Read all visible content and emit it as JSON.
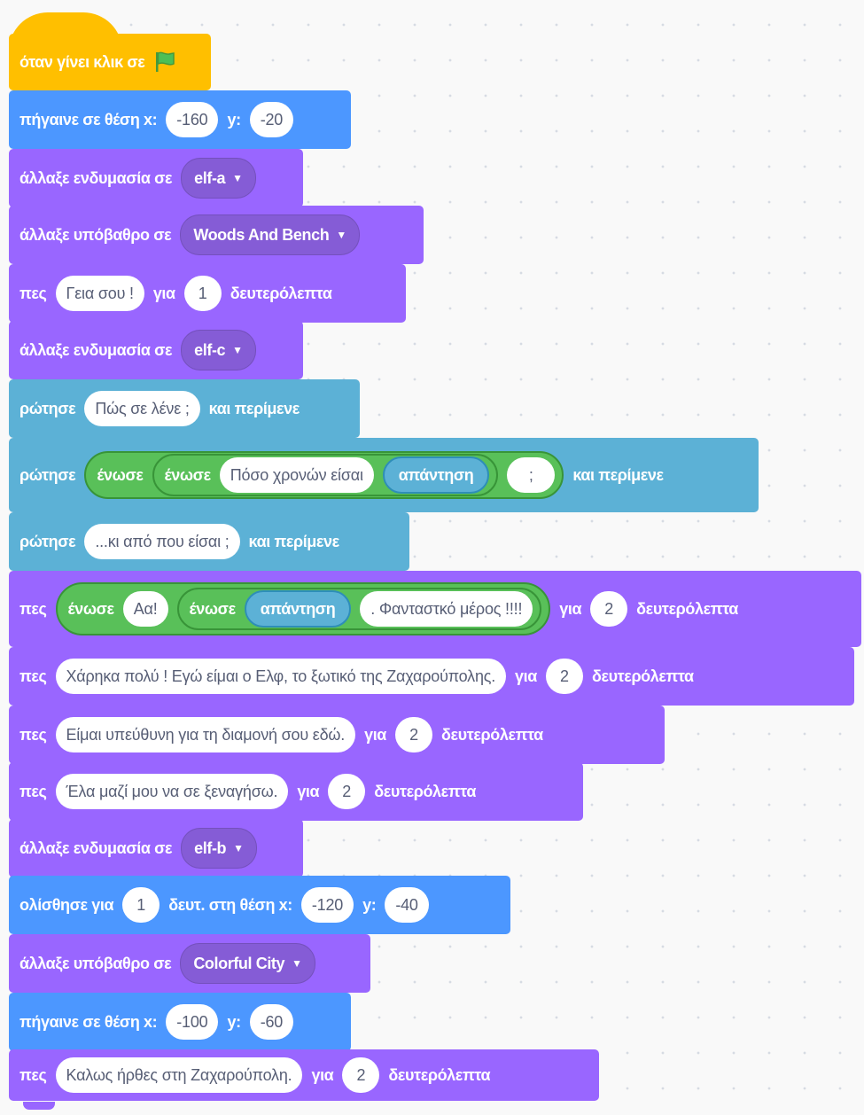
{
  "colors": {
    "events": "#ffbf00",
    "motion": "#4c97ff",
    "looks": "#9966ff",
    "sensing": "#5cb1d6",
    "operators": "#59c059"
  },
  "hat": {
    "label": "όταν γίνει κλικ σε",
    "icon": "green-flag-icon"
  },
  "goto1": {
    "label": "πήγαινε σε θέση x:",
    "x": "-160",
    "ylabel": "y:",
    "y": "-20"
  },
  "costume1": {
    "label": "άλλαξε ενδυμασία σε",
    "value": "elf-a"
  },
  "backdrop1": {
    "label": "άλλαξε υπόβαθρο σε",
    "value": "Woods And Bench"
  },
  "say1": {
    "label": "πες",
    "text": "Γεια σου !",
    "for": "για",
    "secs": "1",
    "unit": "δευτερόλεπτα"
  },
  "costume2": {
    "label": "άλλαξε ενδυμασία σε",
    "value": "elf-c"
  },
  "ask1": {
    "label": "ρώτησε",
    "text": "Πώς σε λένε ;",
    "suffix": "και περίμενε"
  },
  "ask2": {
    "label": "ρώτησε",
    "join_outer": "ένωσε",
    "join_inner": "ένωσε",
    "text": "Πόσο χρονών είσαι",
    "answer": "απάντηση",
    "tail": ";",
    "suffix": "και περίμενε"
  },
  "ask3": {
    "label": "ρώτησε",
    "text": "...κι από που είσαι ;",
    "suffix": "και περίμενε"
  },
  "say2": {
    "label": "πες",
    "join_outer": "ένωσε",
    "text1": "Αα!",
    "join_inner": "ένωσε",
    "answer": "απάντηση",
    "text2": ". Φανταστκό μέρος !!!!",
    "for": "για",
    "secs": "2",
    "unit": "δευτερόλεπτα"
  },
  "say3": {
    "label": "πες",
    "text": "Χάρηκα πολύ !  Εγώ είμαι ο Ελφ, το ξωτικό της Ζαχαρούπολης.",
    "for": "για",
    "secs": "2",
    "unit": "δευτερόλεπτα"
  },
  "say4": {
    "label": "πες",
    "text": "Είμαι υπεύθυνη για τη διαμονή σου εδώ.",
    "for": "για",
    "secs": "2",
    "unit": "δευτερόλεπτα"
  },
  "say5": {
    "label": "πες",
    "text": "Έλα μαζί μου να σε ξεναγήσω.",
    "for": "για",
    "secs": "2",
    "unit": "δευτερόλεπτα"
  },
  "costume3": {
    "label": "άλλαξε ενδυμασία σε",
    "value": "elf-b"
  },
  "glide": {
    "label": "ολίσθησε για",
    "secs": "1",
    "mid": "δευτ. στη θέση x:",
    "x": "-120",
    "ylabel": "y:",
    "y": "-40"
  },
  "backdrop2": {
    "label": "άλλαξε υπόβαθρο σε",
    "value": "Colorful City"
  },
  "goto2": {
    "label": "πήγαινε σε θέση x:",
    "x": "-100",
    "ylabel": "y:",
    "y": "-60"
  },
  "say6": {
    "label": "πες",
    "text": "Καλως ήρθες στη Ζαχαρούπολη.",
    "for": "για",
    "secs": "2",
    "unit": "δευτερόλεπτα"
  }
}
